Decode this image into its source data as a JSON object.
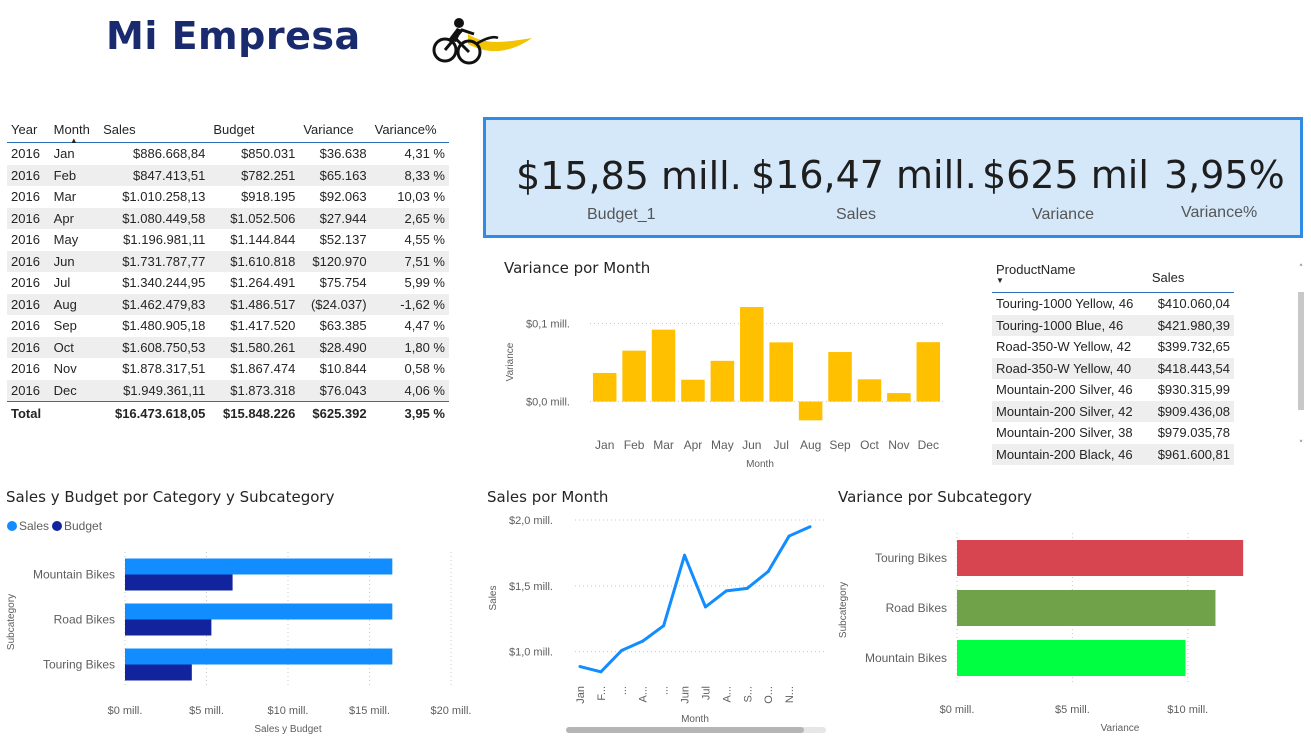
{
  "header": {
    "title": "Mi Empresa",
    "logo_icon": "cyclist-logo-icon"
  },
  "colors": {
    "sales": "#118dff",
    "budget": "#12239e",
    "bar_yellow": "#ffc000",
    "kpi_bg": "#d4e8fa",
    "kpi_border": "#2f8be6",
    "touring": "#d64550",
    "road": "#70a24a",
    "mountain": "#00ff41"
  },
  "monthly_table": {
    "headers": [
      "Year",
      "Month",
      "Sales",
      "Budget",
      "Variance",
      "Variance%"
    ],
    "sort_indicator": "▲",
    "rows": [
      [
        "2016",
        "Jan",
        "$886.668,84",
        "$850.031",
        "$36.638",
        "4,31 %"
      ],
      [
        "2016",
        "Feb",
        "$847.413,51",
        "$782.251",
        "$65.163",
        "8,33 %"
      ],
      [
        "2016",
        "Mar",
        "$1.010.258,13",
        "$918.195",
        "$92.063",
        "10,03 %"
      ],
      [
        "2016",
        "Apr",
        "$1.080.449,58",
        "$1.052.506",
        "$27.944",
        "2,65 %"
      ],
      [
        "2016",
        "May",
        "$1.196.981,11",
        "$1.144.844",
        "$52.137",
        "4,55 %"
      ],
      [
        "2016",
        "Jun",
        "$1.731.787,77",
        "$1.610.818",
        "$120.970",
        "7,51 %"
      ],
      [
        "2016",
        "Jul",
        "$1.340.244,95",
        "$1.264.491",
        "$75.754",
        "5,99 %"
      ],
      [
        "2016",
        "Aug",
        "$1.462.479,83",
        "$1.486.517",
        "($24.037)",
        "-1,62 %"
      ],
      [
        "2016",
        "Sep",
        "$1.480.905,18",
        "$1.417.520",
        "$63.385",
        "4,47 %"
      ],
      [
        "2016",
        "Oct",
        "$1.608.750,53",
        "$1.580.261",
        "$28.490",
        "1,80 %"
      ],
      [
        "2016",
        "Nov",
        "$1.878.317,51",
        "$1.867.474",
        "$10.844",
        "0,58 %"
      ],
      [
        "2016",
        "Dec",
        "$1.949.361,11",
        "$1.873.318",
        "$76.043",
        "4,06 %"
      ]
    ],
    "total": {
      "label": "Total",
      "sales": "$16.473.618,05",
      "budget": "$15.848.226",
      "variance": "$625.392",
      "variance_pct": "3,95 %"
    }
  },
  "kpis": [
    {
      "value": "$15,85 mill.",
      "label": "Budget_1"
    },
    {
      "value": "$16,47 mill.",
      "label": "Sales"
    },
    {
      "value": "$625 mil",
      "label": "Variance"
    },
    {
      "value": "3,95%",
      "label": "Variance%"
    }
  ],
  "product_table": {
    "headers": [
      "ProductName",
      "Sales"
    ],
    "sort_indicator": "▼",
    "rows": [
      [
        "Touring-1000 Yellow, 46",
        "$410.060,04"
      ],
      [
        "Touring-1000 Blue, 46",
        "$421.980,39"
      ],
      [
        "Road-350-W Yellow, 42",
        "$399.732,65"
      ],
      [
        "Road-350-W Yellow, 40",
        "$418.443,54"
      ],
      [
        "Mountain-200 Silver, 46",
        "$930.315,99"
      ],
      [
        "Mountain-200 Silver, 42",
        "$909.436,08"
      ],
      [
        "Mountain-200 Silver, 38",
        "$979.035,78"
      ],
      [
        "Mountain-200 Black, 46",
        "$961.600,81"
      ]
    ],
    "scroll_up": "˄",
    "scroll_down": "˅"
  },
  "chart_data": [
    {
      "id": "variance_by_month",
      "type": "bar",
      "title": "Variance por Month",
      "xlabel": "Month",
      "ylabel": "Variance",
      "categories": [
        "Jan",
        "Feb",
        "Mar",
        "Apr",
        "May",
        "Jun",
        "Jul",
        "Aug",
        "Sep",
        "Oct",
        "Nov",
        "Dec"
      ],
      "values": [
        36638,
        65163,
        92063,
        27944,
        52137,
        120970,
        75754,
        -24037,
        63385,
        28490,
        10844,
        76043
      ],
      "y_ticks": [
        {
          "value": 0,
          "label": "$0,0 mill."
        },
        {
          "value": 100000,
          "label": "$0,1 mill."
        }
      ],
      "grid": true
    },
    {
      "id": "sales_budget_by_subcategory",
      "type": "bar",
      "orientation": "horizontal",
      "title": "Sales y Budget por Category y Subcategory",
      "xlabel": "Sales y Budget",
      "ylabel": "Subcategory",
      "categories": [
        "Mountain Bikes",
        "Road Bikes",
        "Touring Bikes"
      ],
      "series": [
        {
          "name": "Sales",
          "values": [
            16.4,
            16.4,
            16.4
          ]
        },
        {
          "name": "Budget",
          "values": [
            6.6,
            5.3,
            4.1
          ]
        }
      ],
      "x_ticks": [
        {
          "value": 0,
          "label": "$0 mill."
        },
        {
          "value": 5,
          "label": "$5 mill."
        },
        {
          "value": 10,
          "label": "$10 mill."
        },
        {
          "value": 15,
          "label": "$15 mill."
        },
        {
          "value": 20,
          "label": "$20 mill."
        }
      ],
      "xlim": [
        0,
        20
      ],
      "legend": "top-left",
      "grid": true
    },
    {
      "id": "sales_by_month",
      "type": "line",
      "title": "Sales por Month",
      "xlabel": "Month",
      "ylabel": "Sales",
      "categories": [
        "Jan",
        "F...",
        "...",
        "A...",
        "...",
        "Jun",
        "Jul",
        "A...",
        "S...",
        "O...",
        "N...",
        ""
      ],
      "values": [
        0.887,
        0.847,
        1.01,
        1.08,
        1.197,
        1.732,
        1.34,
        1.462,
        1.481,
        1.609,
        1.878,
        1.949
      ],
      "y_ticks": [
        {
          "value": 1.0,
          "label": "$1,0 mill."
        },
        {
          "value": 1.5,
          "label": "$1,5 mill."
        },
        {
          "value": 2.0,
          "label": "$2,0 mill."
        }
      ],
      "ylim": [
        0.8,
        2.0
      ],
      "grid": true
    },
    {
      "id": "variance_by_subcategory",
      "type": "bar",
      "orientation": "horizontal",
      "title": "Variance por Subcategory",
      "xlabel": "Variance",
      "ylabel": "Subcategory",
      "categories": [
        "Touring Bikes",
        "Road Bikes",
        "Mountain Bikes"
      ],
      "values": [
        12.4,
        11.2,
        9.9
      ],
      "colors": [
        "#d64550",
        "#70a24a",
        "#00ff41"
      ],
      "x_ticks": [
        {
          "value": 0,
          "label": "$0 mill."
        },
        {
          "value": 5,
          "label": "$5 mill."
        },
        {
          "value": 10,
          "label": "$10 mill."
        }
      ],
      "xlim": [
        0,
        13
      ],
      "grid": true
    }
  ]
}
